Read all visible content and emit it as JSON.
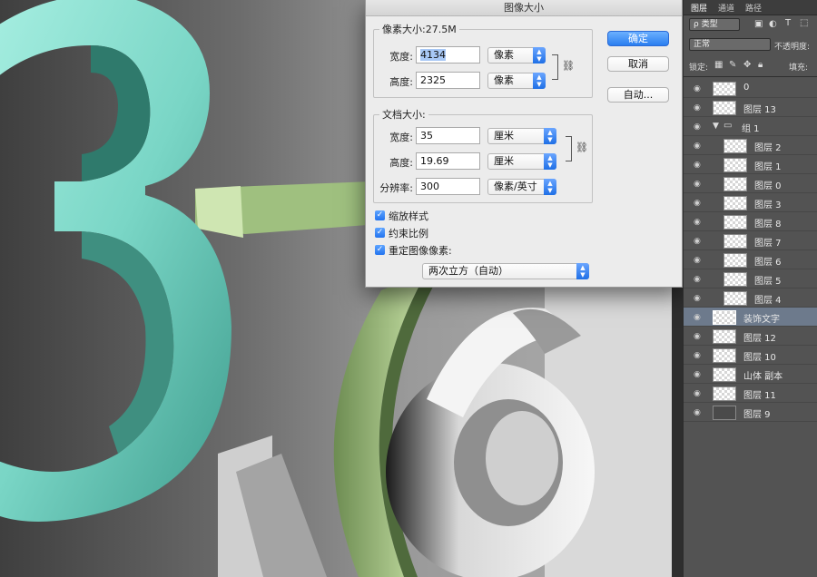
{
  "dialog": {
    "title": "图像大小",
    "pixel_dimensions_label": "像素大小:27.5M",
    "width_label": "宽度:",
    "height_label": "高度:",
    "pixel_width": "4134",
    "pixel_height": "2325",
    "pixel_unit": "像素",
    "document_size_label": "文档大小:",
    "doc_width": "35",
    "doc_height": "19.69",
    "doc_unit": "厘米",
    "resolution_label": "分辨率:",
    "resolution": "300",
    "resolution_unit": "像素/英寸",
    "chain_icon": "link-icon",
    "ok_label": "确定",
    "cancel_label": "取消",
    "auto_label": "自动...",
    "scale_styles_label": "缩放样式",
    "scale_styles_checked": true,
    "constrain_label": "约束比例",
    "constrain_checked": true,
    "resample_label": "重定图像像素:",
    "resample_checked": true,
    "resample_method": "两次立方（自动）"
  },
  "panel": {
    "tabs": [
      "图层",
      "通道",
      "路径"
    ],
    "filter_label": "ρ 类型",
    "blend_mode": "正常",
    "opacity_label": "不透明度:",
    "lock_label": "锁定:",
    "fill_label": "填充:",
    "layers": [
      {
        "name": "0"
      },
      {
        "name": "图层 13"
      },
      {
        "name": "组 1"
      },
      {
        "name": "图层 2"
      },
      {
        "name": "图层 1"
      },
      {
        "name": "图层 0"
      },
      {
        "name": "图层 3"
      },
      {
        "name": "图层 8"
      },
      {
        "name": "图层 7"
      },
      {
        "name": "图层 6"
      },
      {
        "name": "图层 5"
      },
      {
        "name": "图层 4"
      },
      {
        "name": "装饰文字"
      },
      {
        "name": "图层 12"
      },
      {
        "name": "图层 10"
      },
      {
        "name": "山体 副本"
      },
      {
        "name": "图层 11"
      },
      {
        "name": "图层 9"
      }
    ]
  },
  "colors": {
    "accent": "#2a7ef0",
    "teal_digit": "#7fd9c9",
    "green_arc": "#b8d59a",
    "selected_layer": "#6d7a8c"
  }
}
